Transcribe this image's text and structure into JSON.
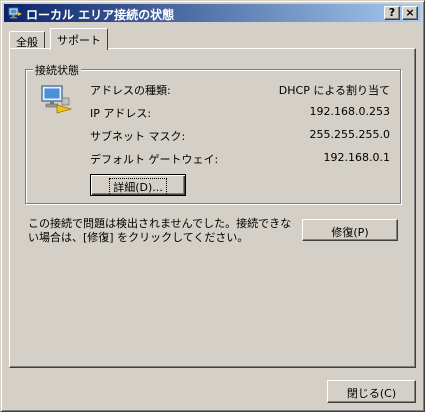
{
  "window": {
    "title": "ローカル エリア接続の状態",
    "help_label": "?",
    "close_label": "×"
  },
  "tabs": [
    {
      "label": "全般",
      "active": false
    },
    {
      "label": "サポート",
      "active": true
    }
  ],
  "group": {
    "title": "接続状態",
    "rows": [
      {
        "label": "アドレスの種類:",
        "value": "DHCP による割り当て"
      },
      {
        "label": "IP アドレス:",
        "value": "192.168.0.253"
      },
      {
        "label": "サブネット マスク:",
        "value": "255.255.255.0"
      },
      {
        "label": "デフォルト ゲートウェイ:",
        "value": "192.168.0.1"
      }
    ],
    "details_button": "詳細(D)..."
  },
  "message": "この接続で問題は検出されませんでした。接続できない場合は、[修復] をクリックしてください。",
  "repair_button": "修復(P)",
  "close_button": "閉じる(C)",
  "icons": {
    "title": "network-connection-icon",
    "status": "network-connection-icon"
  },
  "colors": {
    "titlebar_start": "#0a246a",
    "titlebar_end": "#a6caf0",
    "face": "#d4d0c8"
  }
}
